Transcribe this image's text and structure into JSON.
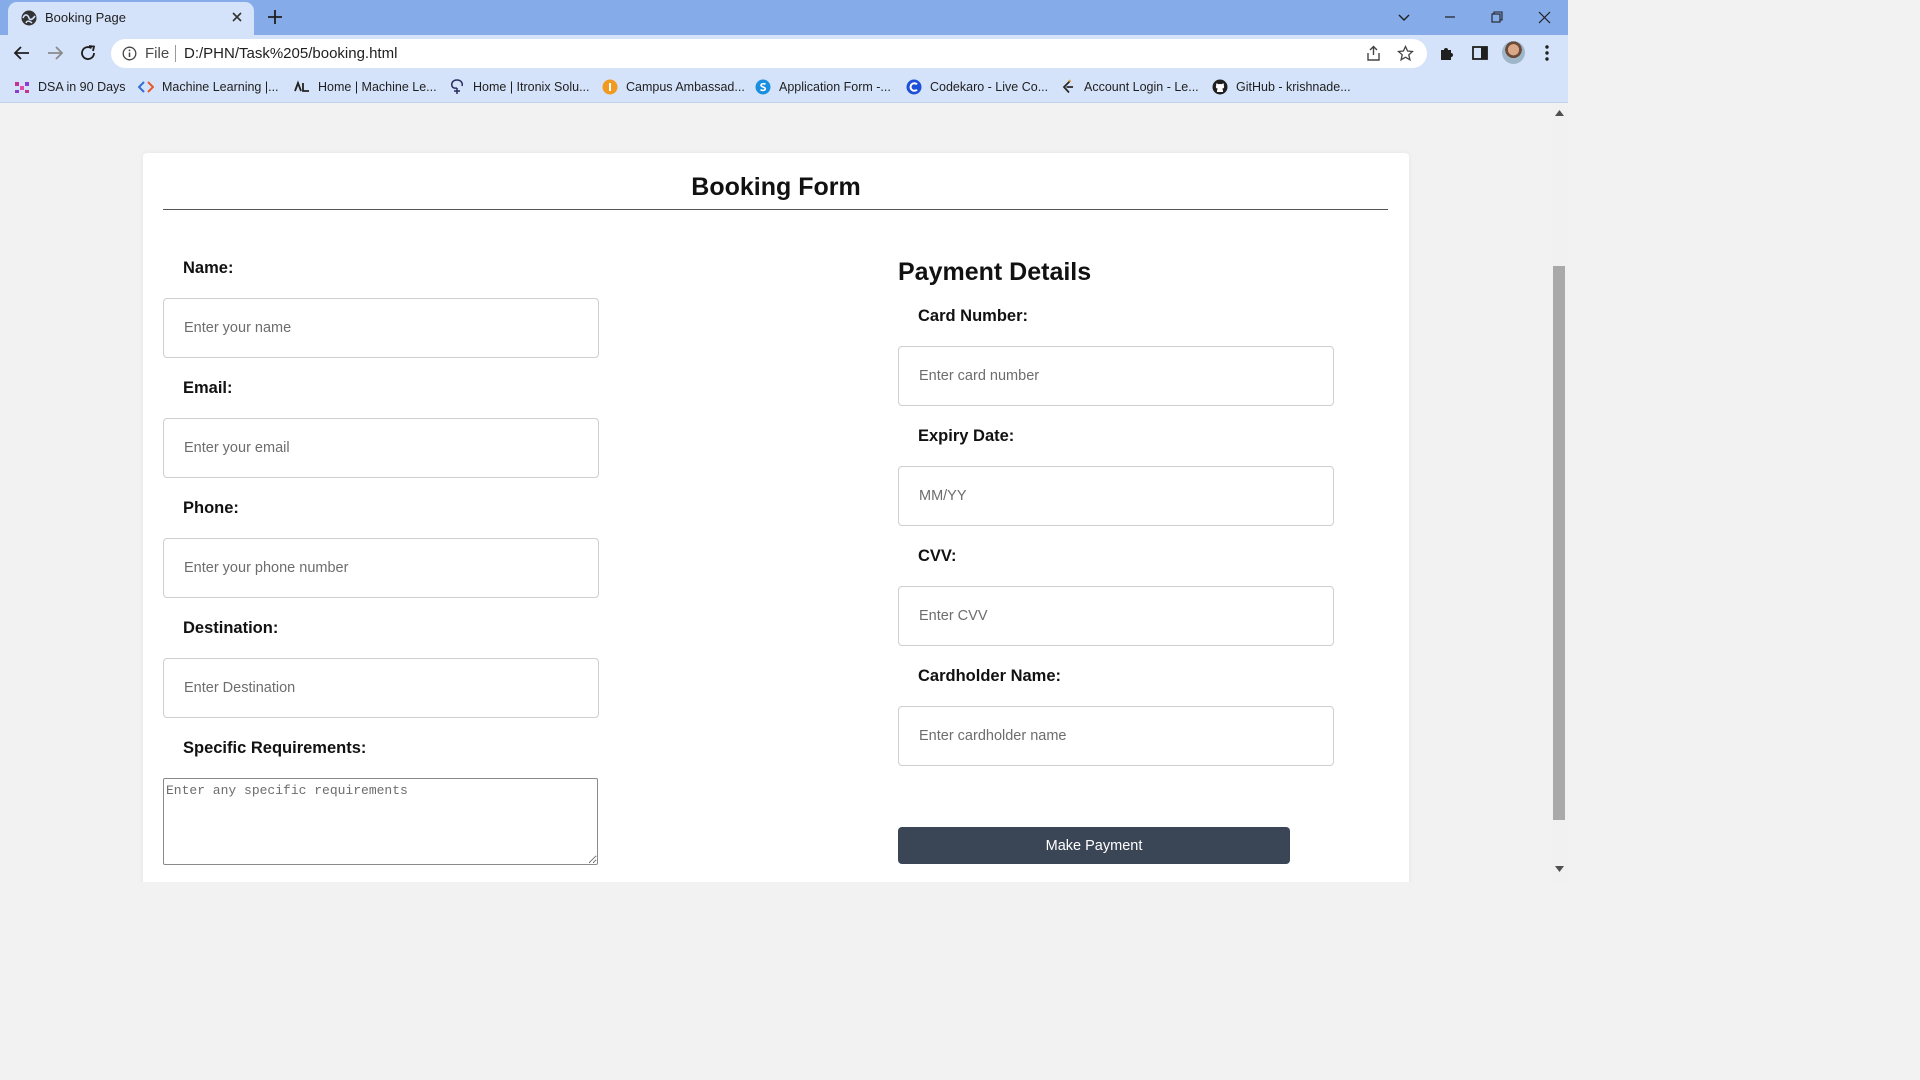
{
  "browser": {
    "tab_title": "Booking Page",
    "url_scheme": "File",
    "url": "D:/PHN/Task%205/booking.html"
  },
  "bookmarks": [
    {
      "label": "DSA in 90 Days",
      "icon": "dsa-icon"
    },
    {
      "label": "Machine Learning |...",
      "icon": "code-icon"
    },
    {
      "label": "Home | Machine Le...",
      "icon": "ml-icon"
    },
    {
      "label": "Home | Itronix Solu...",
      "icon": "itronix-icon"
    },
    {
      "label": "Campus Ambassad...",
      "icon": "campus-icon"
    },
    {
      "label": "Application Form -...",
      "icon": "skype-icon"
    },
    {
      "label": "Codekaro - Live Co...",
      "icon": "codekaro-icon"
    },
    {
      "label": "Account Login - Le...",
      "icon": "leetcode-icon"
    },
    {
      "label": "GitHub - krishnade...",
      "icon": "github-icon"
    }
  ],
  "form": {
    "title": "Booking Form",
    "name_label": "Name:",
    "name_placeholder": "Enter your name",
    "email_label": "Email:",
    "email_placeholder": "Enter your email",
    "phone_label": "Phone:",
    "phone_placeholder": "Enter your phone number",
    "destination_label": "Destination:",
    "destination_placeholder": "Enter Destination",
    "requirements_label": "Specific Requirements:",
    "requirements_placeholder": "Enter any specific requirements"
  },
  "payment": {
    "title": "Payment Details",
    "card_label": "Card Number:",
    "card_placeholder": "Enter card number",
    "expiry_label": "Expiry Date:",
    "expiry_placeholder": "MM/YY",
    "cvv_label": "CVV:",
    "cvv_placeholder": "Enter CVV",
    "holder_label": "Cardholder Name:",
    "holder_placeholder": "Enter cardholder name",
    "submit_label": "Make Payment"
  },
  "colors": {
    "tab_strip": "#86abe9",
    "toolbar": "#d5e3fa",
    "page_background": "#f2f2f2",
    "button": "#3a4556"
  }
}
